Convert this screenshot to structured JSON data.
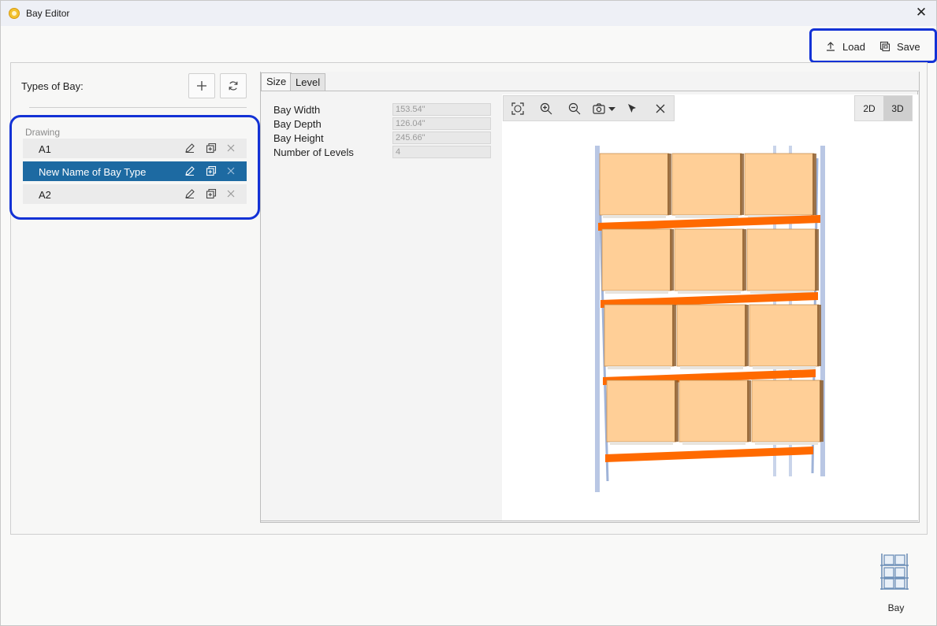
{
  "window": {
    "title": "Bay Editor",
    "close_glyph": "✕"
  },
  "toolbar": {
    "load_label": "Load",
    "save_label": "Save",
    "load_icon": "upload-icon",
    "save_icon": "save-icon"
  },
  "sidebar": {
    "title": "Types of Bay:",
    "add_icon": "plus-icon",
    "refresh_icon": "refresh-icon",
    "group_label": "Drawing",
    "items": [
      {
        "label": "A1",
        "selected": false
      },
      {
        "label": "New Name of Bay Type",
        "selected": true
      },
      {
        "label": "A2",
        "selected": false
      }
    ],
    "item_actions": [
      "edit-icon",
      "duplicate-icon",
      "delete-icon"
    ]
  },
  "tabs": [
    {
      "label": "Size",
      "active": true
    },
    {
      "label": "Level",
      "active": false
    }
  ],
  "properties": [
    {
      "label": "Bay Width",
      "value": "153.54\""
    },
    {
      "label": "Bay Depth",
      "value": "126.04\""
    },
    {
      "label": "Bay Height",
      "value": "245.66\""
    },
    {
      "label": "Number of Levels",
      "value": "4"
    }
  ],
  "viewer": {
    "tools": [
      "fit-view-icon",
      "zoom-in-icon",
      "zoom-out-icon",
      "camera-icon",
      "pointer-icon",
      "clear-icon"
    ],
    "mode_2d": "2D",
    "mode_3d": "3D",
    "active_mode": "3D",
    "colors": {
      "beam": "#ff6a00",
      "box": "#ffcf97",
      "upright": "#9fb3d8"
    }
  },
  "launcher": {
    "label": "Bay",
    "icon": "bay-icon"
  }
}
